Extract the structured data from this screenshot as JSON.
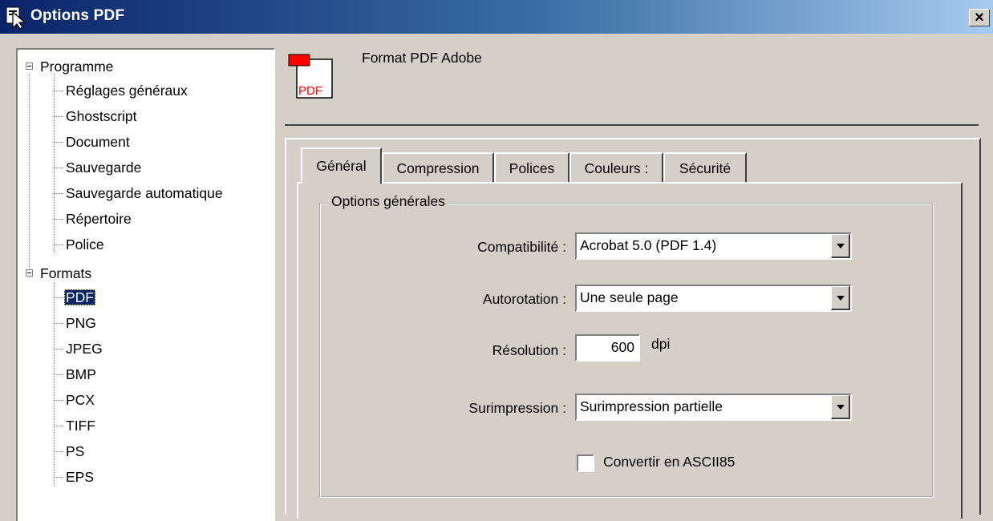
{
  "window": {
    "title": "Options PDF",
    "close_label": "×"
  },
  "tree": {
    "programme": {
      "label": "Programme",
      "children": [
        "Réglages généraux",
        "Ghostscript",
        "Document",
        "Sauvegarde",
        "Sauvegarde automatique",
        "Répertoire",
        "Police"
      ]
    },
    "formats": {
      "label": "Formats",
      "children": [
        "PDF",
        "PNG",
        "JPEG",
        "BMP",
        "PCX",
        "TIFF",
        "PS",
        "EPS"
      ],
      "selected": "PDF"
    }
  },
  "header": {
    "icon_text": "PDF",
    "title": "Format PDF Adobe"
  },
  "tabs": [
    "Général",
    "Compression",
    "Polices",
    "Couleurs :",
    "Sécurité"
  ],
  "active_tab": "Général",
  "group": {
    "title": "Options générales",
    "compat_label": "Compatibilité :",
    "compat_value": "Acrobat 5.0 (PDF 1.4)",
    "autorotation_label": "Autorotation :",
    "autorotation_value": "Une seule page",
    "resolution_label": "Résolution :",
    "resolution_value": "600",
    "resolution_unit": "dpi",
    "overprint_label": "Surimpression :",
    "overprint_value": "Surimpression partielle",
    "ascii85_label": "Convertir en ASCII85",
    "ascii85_checked": false
  },
  "colors": {
    "title_start": "#0a246a",
    "face": "#d4d0c8",
    "selection": "#0a246a",
    "pdf_red": "#ff0000"
  }
}
